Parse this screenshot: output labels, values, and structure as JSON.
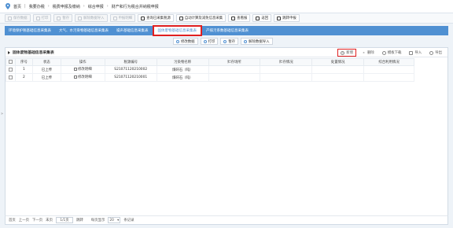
{
  "breadcrumb": [
    "首页",
    "我要办税",
    "税费申报及缴纳",
    "综合申报",
    "财产和行为税合并纳税申报"
  ],
  "toolbar": [
    {
      "label": "保存数据",
      "disabled": true
    },
    {
      "label": "打印",
      "disabled": true
    },
    {
      "label": "暂存",
      "disabled": true
    },
    {
      "label": "解除数据导入",
      "disabled": true
    },
    {
      "label": "申报明细",
      "disabled": true
    },
    {
      "label": "查询已采集税源",
      "disabled": false
    },
    {
      "label": "自动计算及减免信息采集",
      "disabled": false
    },
    {
      "label": "查看报",
      "disabled": false
    },
    {
      "label": "返回",
      "disabled": false
    },
    {
      "label": "跳转申报",
      "disabled": false
    }
  ],
  "tabs": [
    "环境保护税基础信息采集表",
    "大气、水污染物基础信息采集表",
    "噪声基础信息采集表",
    "固体废物基础信息采集表",
    "产排污系数基础信息采集表"
  ],
  "active_tab": "固体废物基础信息采集表",
  "subtoolbar": [
    "修改数据",
    "打印",
    "暂存",
    "解除数据导入"
  ],
  "panel": {
    "title": "固体废物基础信息采集表",
    "actions": [
      {
        "label": "新增",
        "icon": "plus-icon",
        "boxed": true
      },
      {
        "label": "删除",
        "icon": "close-icon",
        "boxed": false
      },
      {
        "label": "模板下载",
        "icon": "download-icon",
        "boxed": false
      },
      {
        "label": "导入",
        "icon": "import-icon",
        "boxed": false
      },
      {
        "label": "导出",
        "icon": "export-icon",
        "boxed": false
      }
    ]
  },
  "table": {
    "columns": [
      "",
      "序号",
      "状态",
      "操作",
      "税源编号",
      "污染物名称",
      "贮存场所",
      "贮存情况",
      "处置情况",
      "综合利用情况"
    ],
    "rows": [
      [
        "",
        "1",
        "已上传",
        "修改明细",
        "S21071120210002",
        "煤矸石（吨）",
        "",
        "",
        "",
        ""
      ],
      [
        "",
        "2",
        "已上传",
        "修改明细",
        "S21071120210001",
        "煤矸石（吨）",
        "",
        "",
        "",
        ""
      ]
    ]
  },
  "footer": {
    "first": "首页",
    "prev": "上一页",
    "next": "下一页",
    "last": "末页",
    "page_value": "1/1页",
    "goto": "跳转",
    "page_size_label": "每页显示",
    "page_size": "20",
    "unit": "条记录"
  },
  "colors": {
    "accent": "#4f90d2",
    "highlight": "#e02020"
  }
}
